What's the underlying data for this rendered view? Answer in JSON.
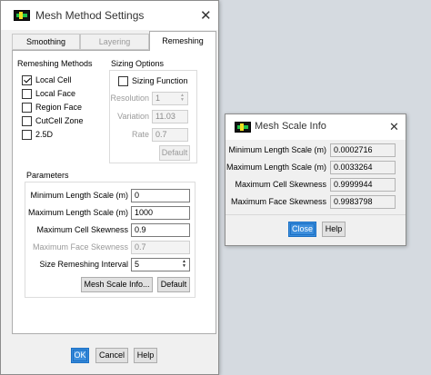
{
  "settings_dialog": {
    "title": "Mesh Method Settings",
    "tabs": [
      {
        "label": "Smoothing",
        "state": "inactive"
      },
      {
        "label": "Layering",
        "state": "disabled"
      },
      {
        "label": "Remeshing",
        "state": "active"
      }
    ],
    "remeshing_methods": {
      "header": "Remeshing Methods",
      "items": [
        {
          "label": "Local Cell",
          "checked": true
        },
        {
          "label": "Local Face",
          "checked": false
        },
        {
          "label": "Region Face",
          "checked": false
        },
        {
          "label": "CutCell Zone",
          "checked": false
        },
        {
          "label": "2.5D",
          "checked": false
        }
      ]
    },
    "sizing_options": {
      "header": "Sizing Options",
      "sizing_function_label": "Sizing Function",
      "resolution_label": "Resolution",
      "resolution_value": "1",
      "variation_label": "Variation",
      "variation_value": "11.03",
      "rate_label": "Rate",
      "rate_value": "0.7",
      "default_label": "Default"
    },
    "parameters": {
      "header": "Parameters",
      "min_length_label": "Minimum Length Scale (m)",
      "min_length_value": "0",
      "max_length_label": "Maximum Length Scale (m)",
      "max_length_value": "1000",
      "max_cell_skew_label": "Maximum Cell Skewness",
      "max_cell_skew_value": "0.9",
      "max_face_skew_label": "Maximum Face Skewness",
      "max_face_skew_value": "0.7",
      "size_interval_label": "Size Remeshing Interval",
      "size_interval_value": "5",
      "mesh_scale_info_label": "Mesh Scale Info...",
      "default_label": "Default"
    },
    "buttons": {
      "ok": "OK",
      "cancel": "Cancel",
      "help": "Help"
    }
  },
  "info_dialog": {
    "title": "Mesh Scale Info",
    "rows": [
      {
        "label": "Minimum Length Scale (m)",
        "value": "0.0002716"
      },
      {
        "label": "Maximum Length Scale (m)",
        "value": "0.0033264"
      },
      {
        "label": "Maximum Cell Skewness",
        "value": "0.9999944"
      },
      {
        "label": "Maximum Face Skewness",
        "value": "0.9983798"
      }
    ],
    "buttons": {
      "close": "Close",
      "help": "Help"
    }
  },
  "icons": {
    "app": "fluent-app-icon",
    "close": "close-icon",
    "spin": "spinner-arrows-icon",
    "check": "checkmark-icon"
  },
  "colors": {
    "primary_button": "#3b8ddc",
    "dialog_bg": "#f0f0f0",
    "desktop_bg": "#d5dae0"
  }
}
